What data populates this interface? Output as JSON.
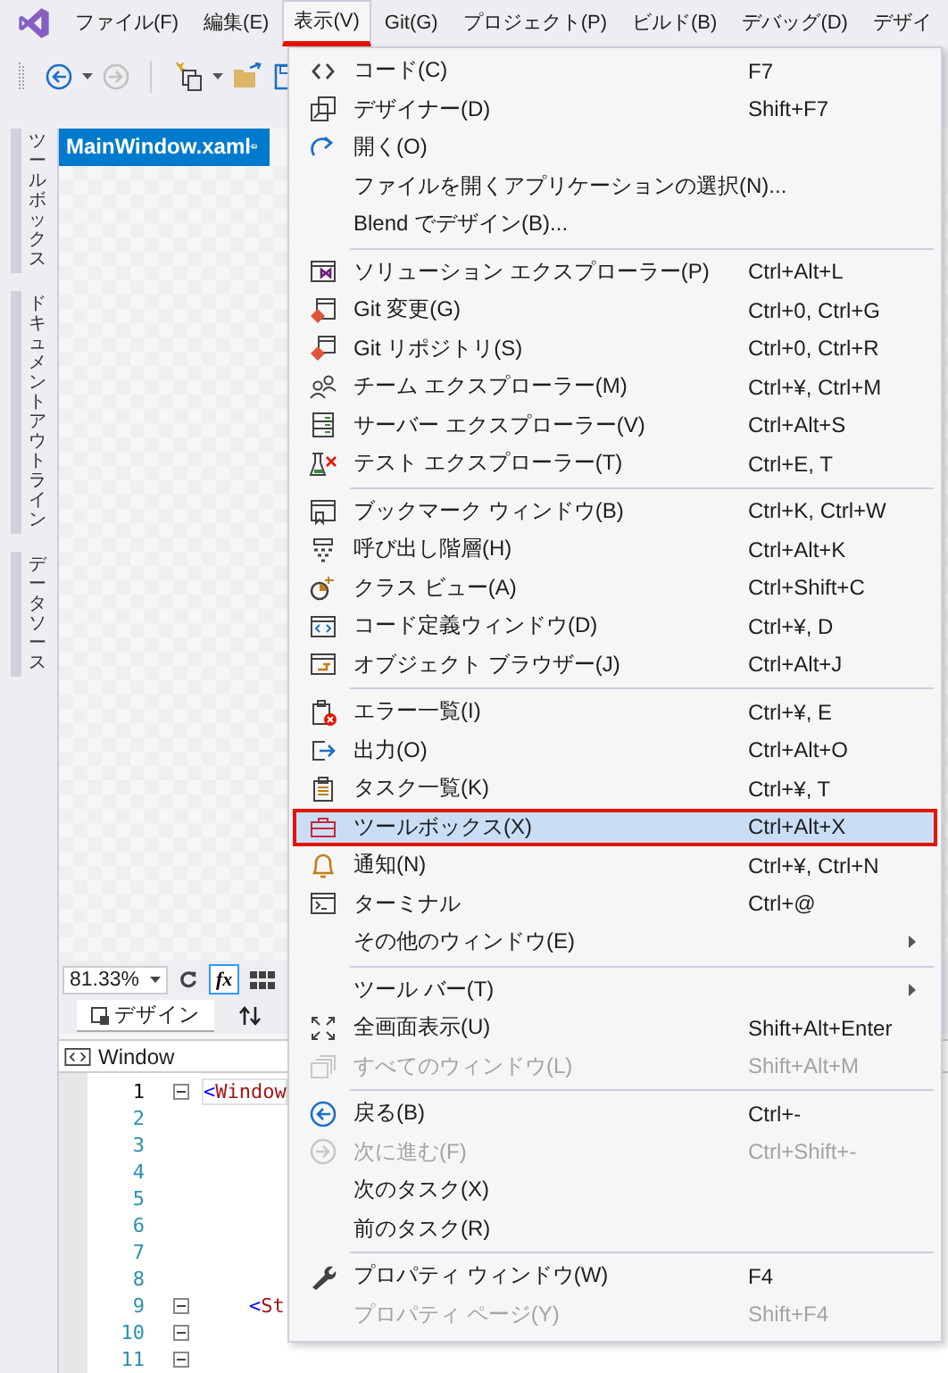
{
  "menubar": [
    {
      "label": "ファイル(F)",
      "selected": false
    },
    {
      "label": "編集(E)",
      "selected": false
    },
    {
      "label": "表示(V)",
      "selected": true
    },
    {
      "label": "Git(G)",
      "selected": false
    },
    {
      "label": "プロジェクト(P)",
      "selected": false
    },
    {
      "label": "ビルド(B)",
      "selected": false
    },
    {
      "label": "デバッグ(D)",
      "selected": false
    },
    {
      "label": "デザイ",
      "selected": false
    }
  ],
  "side_tabs": [
    "ツールボックス",
    "ドキュメントアウトライン",
    "データソース"
  ],
  "document_tab": {
    "title": "MainWindow.xaml"
  },
  "designer": {
    "zoom": "81.33%",
    "fx": "fx",
    "view_tabs": [
      {
        "label": "デザイン",
        "selected": true
      }
    ]
  },
  "breadcrumb": "Window",
  "code_lines": [
    {
      "number": "1",
      "bracket": "<",
      "name": "Window",
      "fold": true,
      "current": true
    },
    {
      "number": "2",
      "current": false
    },
    {
      "number": "3",
      "current": false
    },
    {
      "number": "4",
      "current": false
    },
    {
      "number": "5",
      "current": false
    },
    {
      "number": "6",
      "current": false
    },
    {
      "number": "7",
      "current": false
    },
    {
      "number": "8",
      "current": false
    },
    {
      "number": "9",
      "bracket": "    <",
      "name": "St",
      "fold": true,
      "current": false
    },
    {
      "number": "10",
      "fold": true,
      "current": false
    },
    {
      "number": "11",
      "fold": true,
      "current": false
    }
  ],
  "view_menu": {
    "groups": [
      [
        {
          "label": "コード(C)",
          "shortcut": "F7",
          "disabled": false,
          "selected": false
        },
        {
          "label": "デザイナー(D)",
          "shortcut": "Shift+F7",
          "disabled": false,
          "selected": false
        },
        {
          "label": "開く(O)",
          "disabled": false,
          "selected": false
        },
        {
          "label": "ファイルを開くアプリケーションの選択(N)...",
          "disabled": false,
          "selected": false
        },
        {
          "label": "Blend でデザイン(B)...",
          "disabled": false,
          "selected": false
        }
      ],
      [
        {
          "label": "ソリューション エクスプローラー(P)",
          "shortcut": "Ctrl+Alt+L",
          "disabled": false,
          "selected": false
        },
        {
          "label": "Git 変更(G)",
          "shortcut": "Ctrl+0, Ctrl+G",
          "disabled": false,
          "selected": false
        },
        {
          "label": "Git リポジトリ(S)",
          "shortcut": "Ctrl+0, Ctrl+R",
          "disabled": false,
          "selected": false
        },
        {
          "label": "チーム エクスプローラー(M)",
          "shortcut": "Ctrl+¥, Ctrl+M",
          "disabled": false,
          "selected": false
        },
        {
          "label": "サーバー エクスプローラー(V)",
          "shortcut": "Ctrl+Alt+S",
          "disabled": false,
          "selected": false
        },
        {
          "label": "テスト エクスプローラー(T)",
          "shortcut": "Ctrl+E, T",
          "disabled": false,
          "selected": false
        }
      ],
      [
        {
          "label": "ブックマーク ウィンドウ(B)",
          "shortcut": "Ctrl+K, Ctrl+W",
          "disabled": false,
          "selected": false
        },
        {
          "label": "呼び出し階層(H)",
          "shortcut": "Ctrl+Alt+K",
          "disabled": false,
          "selected": false
        },
        {
          "label": "クラス ビュー(A)",
          "shortcut": "Ctrl+Shift+C",
          "disabled": false,
          "selected": false
        },
        {
          "label": "コード定義ウィンドウ(D)",
          "shortcut": "Ctrl+¥, D",
          "disabled": false,
          "selected": false
        },
        {
          "label": "オブジェクト ブラウザー(J)",
          "shortcut": "Ctrl+Alt+J",
          "disabled": false,
          "selected": false
        }
      ],
      [
        {
          "label": "エラー一覧(I)",
          "shortcut": "Ctrl+¥, E",
          "disabled": false,
          "selected": false
        },
        {
          "label": "出力(O)",
          "shortcut": "Ctrl+Alt+O",
          "disabled": false,
          "selected": false
        },
        {
          "label": "タスク一覧(K)",
          "shortcut": "Ctrl+¥, T",
          "disabled": false,
          "selected": false
        },
        {
          "label": "ツールボックス(X)",
          "shortcut": "Ctrl+Alt+X",
          "disabled": false,
          "selected": true
        },
        {
          "label": "通知(N)",
          "shortcut": "Ctrl+¥, Ctrl+N",
          "disabled": false,
          "selected": false
        },
        {
          "label": "ターミナル",
          "shortcut": "Ctrl+@",
          "disabled": false,
          "selected": false
        },
        {
          "label": "その他のウィンドウ(E)",
          "submenu": true,
          "disabled": false,
          "selected": false
        }
      ],
      [
        {
          "label": "ツール バー(T)",
          "submenu": true,
          "disabled": false,
          "selected": false
        },
        {
          "label": "全画面表示(U)",
          "shortcut": "Shift+Alt+Enter",
          "disabled": false,
          "selected": false
        },
        {
          "label": "すべてのウィンドウ(L)",
          "shortcut": "Shift+Alt+M",
          "disabled": true,
          "selected": false
        }
      ],
      [
        {
          "label": "戻る(B)",
          "shortcut": "Ctrl+-",
          "disabled": false,
          "selected": false
        },
        {
          "label": "次に進む(F)",
          "shortcut": "Ctrl+Shift+-",
          "disabled": true,
          "selected": false
        },
        {
          "label": "次のタスク(X)",
          "disabled": false,
          "selected": false
        },
        {
          "label": "前のタスク(R)",
          "disabled": false,
          "selected": false
        }
      ],
      [
        {
          "label": "プロパティ ウィンドウ(W)",
          "shortcut": "F4",
          "disabled": false,
          "selected": false
        },
        {
          "label": "プロパティ ページ(Y)",
          "shortcut": "Shift+F4",
          "disabled": true,
          "selected": false
        }
      ]
    ]
  }
}
